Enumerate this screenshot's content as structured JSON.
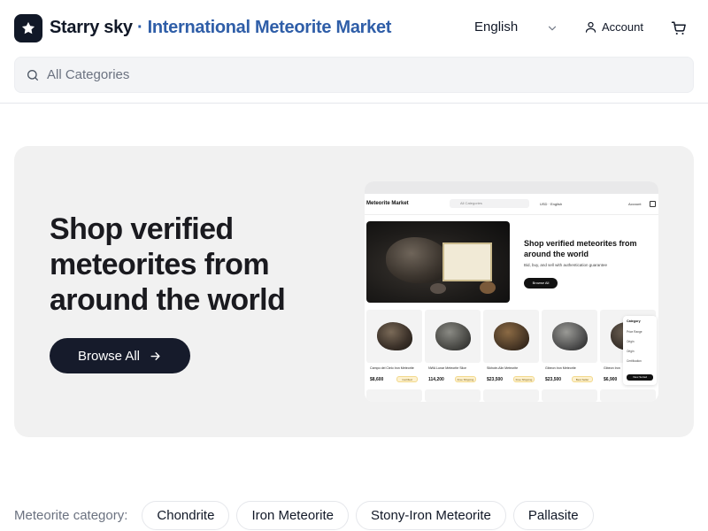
{
  "header": {
    "brand_primary": "Starry sky",
    "brand_separator": " · ",
    "brand_secondary": "International Meteorite Market",
    "language": "English",
    "account_label": "Account",
    "icons": {
      "logo": "star-icon",
      "chevron": "chevron-down-icon",
      "account": "user-icon",
      "cart": "cart-icon"
    }
  },
  "search": {
    "placeholder": "All Categories",
    "icon": "search-icon"
  },
  "hero": {
    "title": "Shop verified meteorites from around the world",
    "button_label": "Browse All",
    "button_icon": "arrow-right-icon",
    "preview": {
      "brand": "Meteorite Market",
      "search_placeholder": "All Categories",
      "currency_lang": "USD · English",
      "account": "Account",
      "title": "Shop verified meteorites from around the world",
      "subtitle": "Bid, buy, and sell with authentication guarantee",
      "button": "Browse All",
      "cards": [
        {
          "name": "Campo del Cielo Iron Meteorite",
          "price": "$8,600",
          "tag": "Certified"
        },
        {
          "name": "NWA Lunar Meteorite Slice",
          "price": "114,200",
          "tag": "Free Shipping"
        },
        {
          "name": "Sikhote-Alin Meteorite",
          "price": "$23,500",
          "tag": "Free Shipping"
        },
        {
          "name": "Gibeon Iron Meteorite",
          "price": "$23,500",
          "tag": "Best Seller"
        },
        {
          "name": "Gibeon Iron",
          "price": "$6,900",
          "tag": ""
        }
      ],
      "filter": {
        "title": "Category",
        "rows": [
          "Price Range",
          "Origin",
          "Origin",
          "Certification"
        ],
        "button": "View Sorted"
      }
    }
  },
  "categories": {
    "label": "Meteorite category:",
    "items": [
      "Chondrite",
      "Iron Meteorite",
      "Stony-Iron Meteorite",
      "Pallasite"
    ]
  },
  "colors": {
    "brand_dark": "#111827",
    "brand_blue": "#2f5ea8",
    "button_dark": "#161b2b",
    "hero_bg": "#f1f1f1"
  }
}
